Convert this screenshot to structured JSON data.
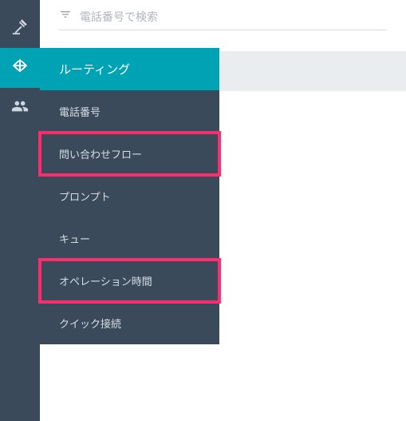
{
  "search": {
    "placeholder": "電話番号で検索"
  },
  "flyout": {
    "header": "ルーティング",
    "items": [
      {
        "label": "電話番号",
        "highlight": false
      },
      {
        "label": "問い合わせフロー",
        "highlight": true
      },
      {
        "label": "プロンプト",
        "highlight": false
      },
      {
        "label": "キュー",
        "highlight": false
      },
      {
        "label": "オペレーション時間",
        "highlight": true
      },
      {
        "label": "クイック接続",
        "highlight": false
      }
    ]
  },
  "rail": {
    "items": [
      {
        "name": "gavel-icon",
        "active": false
      },
      {
        "name": "routing-icon",
        "active": true
      },
      {
        "name": "users-icon",
        "active": false
      }
    ]
  }
}
